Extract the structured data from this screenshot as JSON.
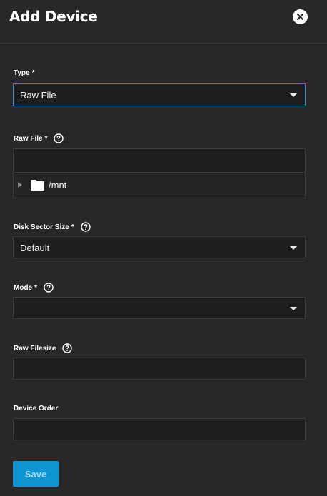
{
  "dialog": {
    "title": "Add Device",
    "close_icon": "close-icon"
  },
  "fields": {
    "type": {
      "label": "Type",
      "required_mark": "*",
      "value": "Raw File"
    },
    "raw_file": {
      "label": "Raw File",
      "required_mark": "*",
      "value": "",
      "tree_root": "/mnt"
    },
    "disk_sector_size": {
      "label": "Disk Sector Size",
      "required_mark": "*",
      "value": "Default"
    },
    "mode": {
      "label": "Mode",
      "required_mark": "*",
      "value": ""
    },
    "raw_filesize": {
      "label": "Raw Filesize",
      "value": ""
    },
    "device_order": {
      "label": "Device Order",
      "value": ""
    }
  },
  "actions": {
    "save_label": "Save"
  },
  "colors": {
    "background": "#282828",
    "field_bg": "#1e1e1e",
    "focus_border": "#1e97d6",
    "primary": "#0e95d3"
  },
  "icons": [
    "close-icon",
    "help-icon",
    "chevron-down-icon",
    "folder-icon",
    "expand-arrow-icon"
  ]
}
